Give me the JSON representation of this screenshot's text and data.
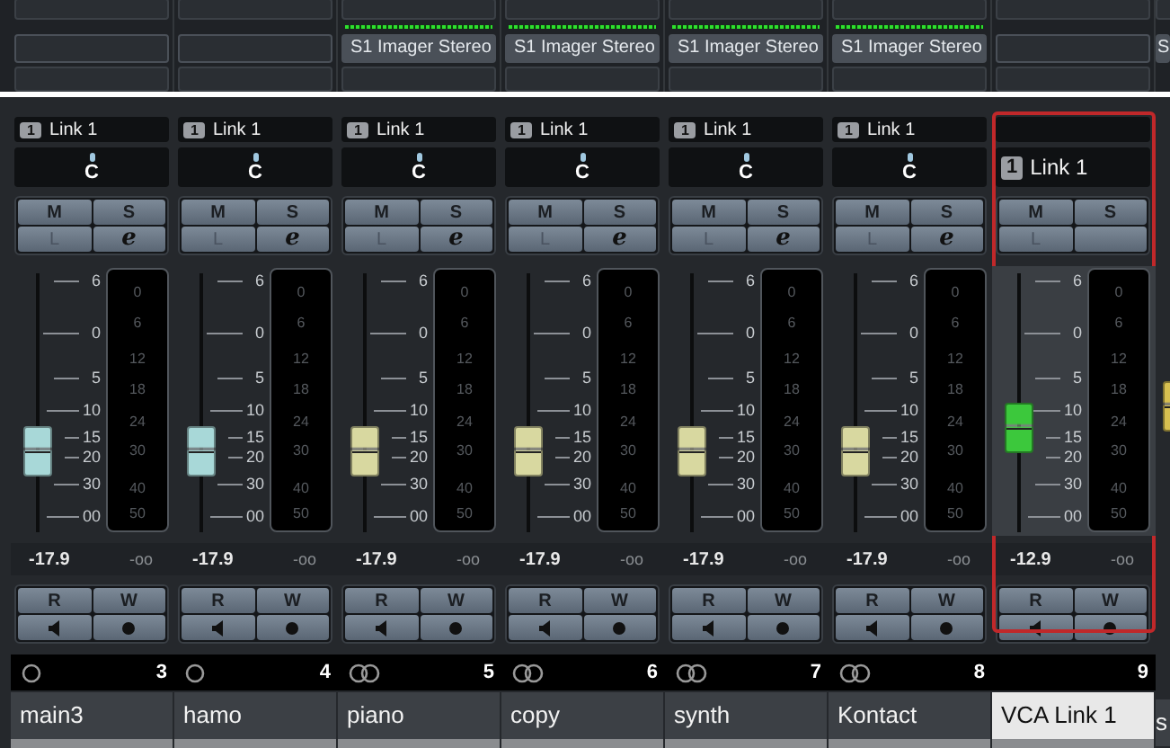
{
  "channels": [
    {
      "kind": "mono",
      "name": "main3",
      "number": "3",
      "meter_active": false,
      "link_badge": "1",
      "link_label": "Link 1",
      "pan": "C",
      "mute": "M",
      "solo": "S",
      "listen": "L",
      "edit": "e",
      "color": "#a8d8d8",
      "level": 0.31,
      "reading": "-17.9",
      "peak": "-oo",
      "read": "R",
      "write": "W",
      "selected": false,
      "fader_scale": [
        "6",
        "0",
        "5",
        "10",
        "15",
        "20",
        "30",
        "00"
      ],
      "meter_scale": [
        "0",
        "6",
        "12",
        "18",
        "24",
        "30",
        "40",
        "50"
      ]
    },
    {
      "kind": "mono",
      "name": "hamo",
      "number": "4",
      "meter_active": false,
      "link_badge": "1",
      "link_label": "Link 1",
      "pan": "C",
      "mute": "M",
      "solo": "S",
      "listen": "L",
      "edit": "e",
      "color": "#a8d8d8",
      "level": 0.31,
      "reading": "-17.9",
      "peak": "-oo",
      "read": "R",
      "write": "W",
      "selected": false,
      "fader_scale": [
        "6",
        "0",
        "5",
        "10",
        "15",
        "20",
        "30",
        "00"
      ],
      "meter_scale": [
        "0",
        "6",
        "12",
        "18",
        "24",
        "30",
        "40",
        "50"
      ]
    },
    {
      "kind": "stereo",
      "name": "piano",
      "number": "5",
      "insert": "S1 Imager Stereo",
      "meter_active": true,
      "link_badge": "1",
      "link_label": "Link 1",
      "pan": "C",
      "mute": "M",
      "solo": "S",
      "listen": "L",
      "edit": "e",
      "color": "#d8d8a0",
      "level": 0.31,
      "reading": "-17.9",
      "peak": "-oo",
      "read": "R",
      "write": "W",
      "selected": false,
      "fader_scale": [
        "6",
        "0",
        "5",
        "10",
        "15",
        "20",
        "30",
        "00"
      ],
      "meter_scale": [
        "0",
        "6",
        "12",
        "18",
        "24",
        "30",
        "40",
        "50"
      ]
    },
    {
      "kind": "stereo",
      "name": "copy",
      "number": "6",
      "insert": "S1 Imager Stereo",
      "meter_active": true,
      "link_badge": "1",
      "link_label": "Link 1",
      "pan": "C",
      "mute": "M",
      "solo": "S",
      "listen": "L",
      "edit": "e",
      "color": "#d8d8a0",
      "level": 0.31,
      "reading": "-17.9",
      "peak": "-oo",
      "read": "R",
      "write": "W",
      "selected": false,
      "fader_scale": [
        "6",
        "0",
        "5",
        "10",
        "15",
        "20",
        "30",
        "00"
      ],
      "meter_scale": [
        "0",
        "6",
        "12",
        "18",
        "24",
        "30",
        "40",
        "50"
      ]
    },
    {
      "kind": "stereo",
      "name": "synth",
      "number": "7",
      "insert": "S1 Imager Stereo",
      "meter_active": true,
      "link_badge": "1",
      "link_label": "Link 1",
      "pan": "C",
      "mute": "M",
      "solo": "S",
      "listen": "L",
      "edit": "e",
      "color": "#d8d8a0",
      "level": 0.31,
      "reading": "-17.9",
      "peak": "-oo",
      "read": "R",
      "write": "W",
      "selected": false,
      "fader_scale": [
        "6",
        "0",
        "5",
        "10",
        "15",
        "20",
        "30",
        "00"
      ],
      "meter_scale": [
        "0",
        "6",
        "12",
        "18",
        "24",
        "30",
        "40",
        "50"
      ]
    },
    {
      "kind": "stereo",
      "name": "Kontact",
      "number": "8",
      "insert": "S1 Imager Stereo",
      "meter_active": true,
      "link_badge": "1",
      "link_label": "Link 1",
      "pan": "C",
      "mute": "M",
      "solo": "S",
      "listen": "L",
      "edit": "e",
      "color": "#d8d8a0",
      "level": 0.31,
      "reading": "-17.9",
      "peak": "-oo",
      "read": "R",
      "write": "W",
      "selected": false,
      "fader_scale": [
        "6",
        "0",
        "5",
        "10",
        "15",
        "20",
        "30",
        "00"
      ],
      "meter_scale": [
        "0",
        "6",
        "12",
        "18",
        "24",
        "30",
        "40",
        "50"
      ]
    },
    {
      "kind": "vca",
      "name": "VCA Link 1",
      "number": "9",
      "meter_active": false,
      "link_badge": "1",
      "link_label": "Link 1",
      "mute": "M",
      "solo": "S",
      "listen": "L",
      "color": "#3cc83c",
      "level": 0.4,
      "reading": "-12.9",
      "peak": "-oo",
      "read": "R",
      "write": "W",
      "selected": true,
      "fader_scale": [
        "6",
        "0",
        "5",
        "10",
        "15",
        "20",
        "30",
        "00"
      ],
      "meter_scale": [
        "0",
        "6",
        "12",
        "18",
        "24",
        "30",
        "40",
        "50"
      ]
    }
  ],
  "edge_channel": {
    "insert": "S",
    "name": "s",
    "color": "#d8c050"
  }
}
